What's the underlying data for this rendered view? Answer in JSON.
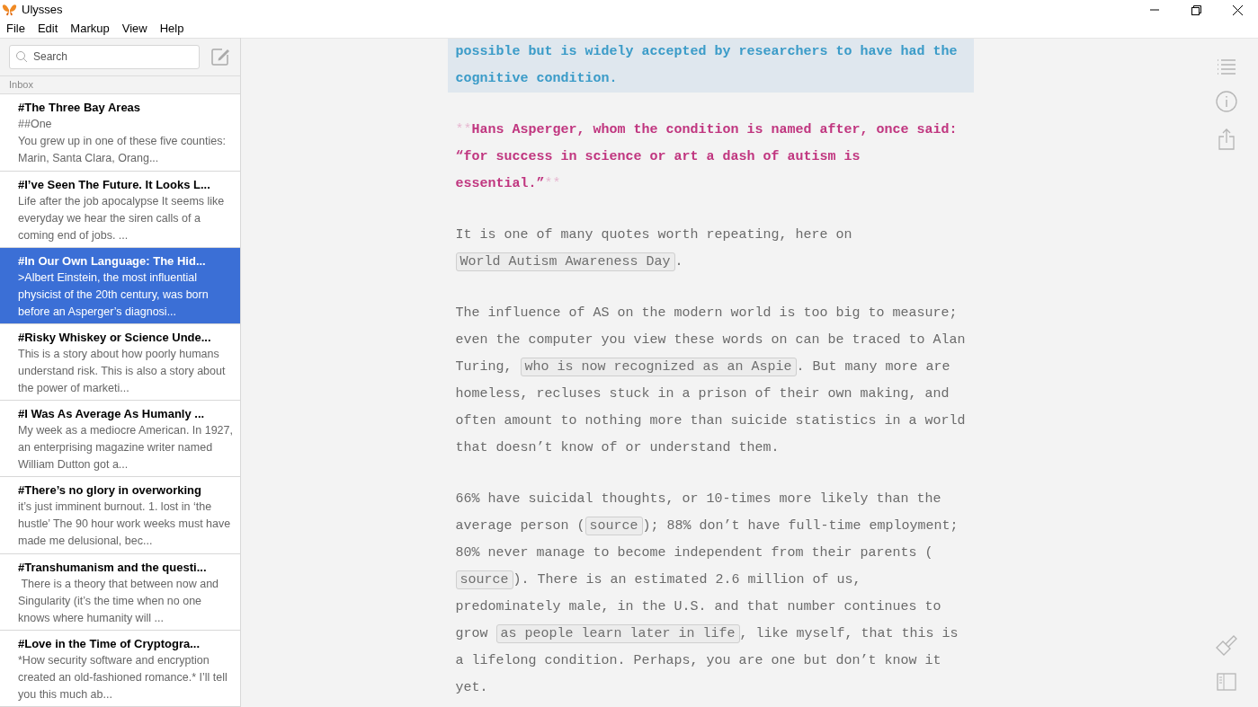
{
  "window": {
    "title": "Ulysses"
  },
  "menu": [
    "File",
    "Edit",
    "Markup",
    "View",
    "Help"
  ],
  "search": {
    "placeholder": "Search"
  },
  "group_label": "Inbox",
  "sheets": [
    {
      "title": "#The Three Bay Areas",
      "excerpt": "##One\nYou grew up in one of these five counties: Marin, Santa Clara, Orang...",
      "selected": false
    },
    {
      "title": "#I’ve Seen The Future. It Looks L...",
      "excerpt": "Life after the job apocalypse It seems like everyday we hear the siren calls of a coming end of jobs. ...",
      "selected": false
    },
    {
      "title": "#In Our Own Language: The Hid...",
      "excerpt": ">Albert Einstein, the most influential physicist of the 20th century, was born before an Asperger’s diagnosi...",
      "selected": true
    },
    {
      "title": "#Risky Whiskey or Science Unde...",
      "excerpt": "This is a story about how poorly humans understand risk. This is also a story about the power of marketi...",
      "selected": false
    },
    {
      "title": "#I Was As Average As Humanly ...",
      "excerpt": "My week as a mediocre American. In 1927, an enterprising magazine writer named William Dutton got a...",
      "selected": false
    },
    {
      "title": "#There’s no glory in overworking",
      "excerpt": "it’s just imminent burnout. 1. lost in ‘the hustle’ The 90 hour work weeks must have made me delusional, bec...",
      "selected": false
    },
    {
      "title": "#Transhumanism and the questi...",
      "excerpt": " There is a theory that between now and Singularity (it’s the time when no one knows where humanity will ...",
      "selected": false
    },
    {
      "title": "#Love in the Time of Cryptogra...",
      "excerpt": "*How security software and encryption created an old-fashioned romance.* I’ll tell you this much ab...",
      "selected": false
    }
  ],
  "editor": [
    {
      "kind": "blockquote",
      "segments": [
        {
          "kind": "plain",
          "text": "possible but is widely accepted by researchers to have had the cognitive condition."
        }
      ]
    },
    {
      "kind": "bold",
      "segments": [
        {
          "kind": "marker",
          "text": "**"
        },
        {
          "kind": "plain",
          "text": "Hans Asperger, whom the condition is named after, once said: “for success in science or art a dash of autism is essential.”"
        },
        {
          "kind": "marker",
          "text": "**"
        }
      ]
    },
    {
      "kind": "text",
      "segments": [
        {
          "kind": "plain",
          "text": "It is one of many quotes worth repeating, here on "
        },
        {
          "kind": "code",
          "text": "World Autism Awareness Day"
        },
        {
          "kind": "plain",
          "text": "."
        }
      ]
    },
    {
      "kind": "text",
      "segments": [
        {
          "kind": "plain",
          "text": "The influence of AS on the modern world is too big to measure; even the computer you view these words on can be traced to Alan Turing, "
        },
        {
          "kind": "code",
          "text": "who is now recognized as an Aspie"
        },
        {
          "kind": "plain",
          "text": ". But many more are homeless, recluses stuck in a prison of their own making, and often amount to nothing more than suicide statistics in a world that doesn’t know of or understand them."
        }
      ]
    },
    {
      "kind": "text",
      "segments": [
        {
          "kind": "plain",
          "text": "66% have suicidal thoughts, or 10-times more likely than the average person ("
        },
        {
          "kind": "code",
          "text": "source"
        },
        {
          "kind": "plain",
          "text": "); 88% don’t have full-time employment; 80% never manage to become independent from their parents ( "
        },
        {
          "kind": "code",
          "text": "source"
        },
        {
          "kind": "plain",
          "text": "). There is an estimated 2.6 million of us, predominately male, in the U.S. and that number continues to grow "
        },
        {
          "kind": "code",
          "text": "as people learn later in life"
        },
        {
          "kind": "plain",
          "text": ", like myself, that this is a lifelong condition. Perhaps, you are one but don’t know it yet."
        }
      ]
    }
  ]
}
